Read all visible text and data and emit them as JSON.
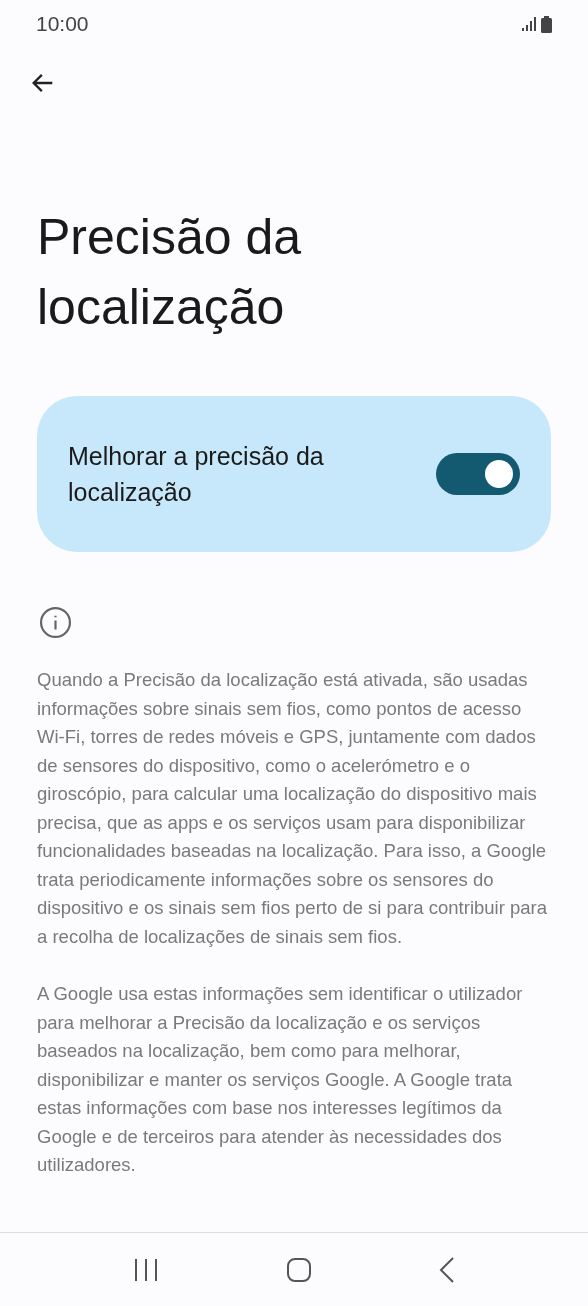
{
  "status_bar": {
    "time": "10:00"
  },
  "title": "Precisão da localização",
  "setting": {
    "label": "Melhorar a precisão da localização",
    "on": true
  },
  "paragraphs": [
    "Quando a Precisão da localização está ativada, são usadas informações sobre sinais sem fios, como pontos de acesso Wi-Fi, torres de redes móveis e GPS, juntamente com dados de sensores do dispositivo, como o acelerómetro e o giroscópio, para calcular uma localização do dispositivo mais precisa, que as apps e os serviços usam para disponibilizar funcionalidades baseadas na localização. Para isso, a Google trata periodicamente informações sobre os sensores do dispositivo e os sinais sem fios perto de si para contribuir para a recolha de localizações de sinais sem fios.",
    "A Google usa estas informações sem identificar o utilizador para melhorar a Precisão da localização e os serviços baseados na localização, bem como para melhorar, disponibilizar e manter os serviços Google. A Google trata estas informações com base nos interesses legítimos da Google e de terceiros para atender às necessidades dos utilizadores."
  ]
}
